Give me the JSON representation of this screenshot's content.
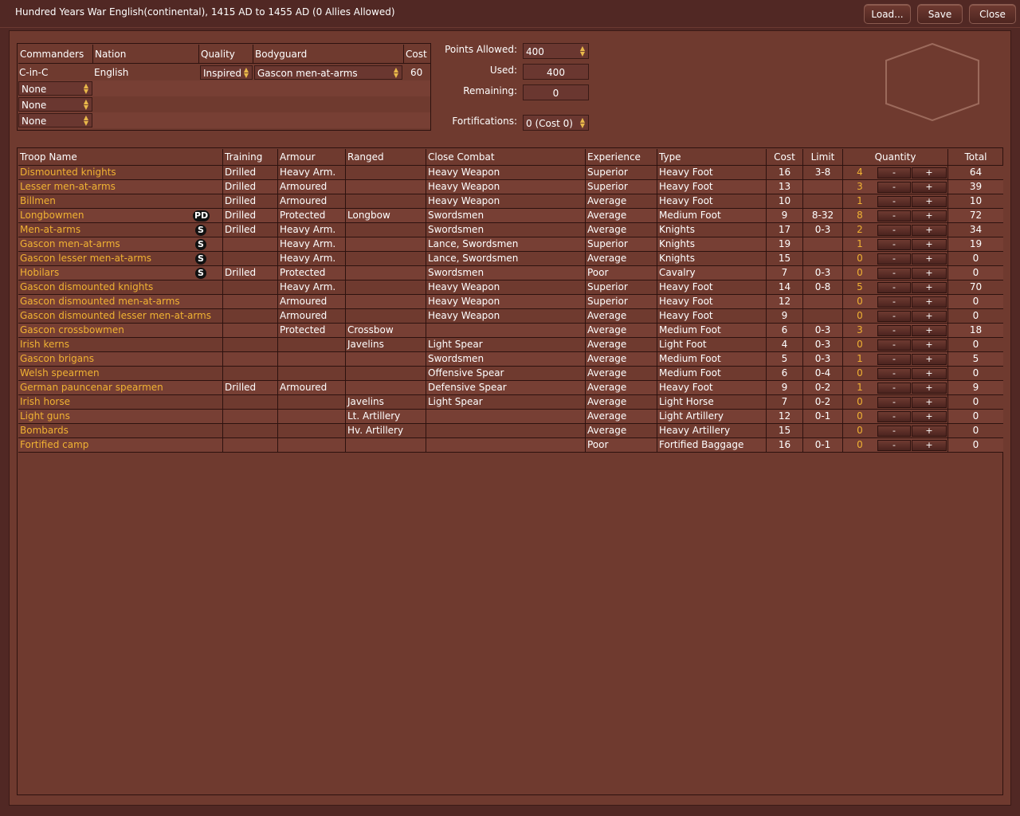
{
  "window": {
    "title": "Hundred Years War English(continental), 1415 AD to 1455 AD (0 Allies Allowed)",
    "buttons": {
      "load": "Load...",
      "save": "Save",
      "close": "Close"
    }
  },
  "commanders": {
    "headers": {
      "commanders": "Commanders",
      "nation": "Nation",
      "quality": "Quality",
      "bodyguard": "Bodyguard",
      "cost": "Cost"
    },
    "cinc": {
      "label": "C-in-C",
      "nation": "English",
      "quality": "Inspired",
      "bodyguard": "Gascon men-at-arms",
      "cost": "60"
    },
    "sub": [
      "None",
      "None",
      "None"
    ]
  },
  "points": {
    "allowed_label": "Points Allowed:",
    "allowed_value": "400",
    "used_label": "Used:",
    "used_value": "400",
    "remaining_label": "Remaining:",
    "remaining_value": "0",
    "fort_label": "Fortifications:",
    "fort_value": "0 (Cost 0)"
  },
  "troops": {
    "headers": {
      "name": "Troop Name",
      "training": "Training",
      "armour": "Armour",
      "ranged": "Ranged",
      "close": "Close Combat",
      "experience": "Experience",
      "type": "Type",
      "cost": "Cost",
      "limit": "Limit",
      "quantity": "Quantity",
      "total": "Total"
    },
    "minus": "-",
    "plus": "+",
    "rows": [
      {
        "name": "Dismounted knights",
        "badge": "",
        "training": "Drilled",
        "armour": "Heavy Arm.",
        "ranged": "",
        "close": "Heavy Weapon",
        "experience": "Superior",
        "type": "Heavy Foot",
        "cost": "16",
        "limit": "3-8",
        "qty": "4",
        "total": "64"
      },
      {
        "name": "Lesser men-at-arms",
        "badge": "",
        "training": "Drilled",
        "armour": "Armoured",
        "ranged": "",
        "close": "Heavy Weapon",
        "experience": "Superior",
        "type": "Heavy Foot",
        "cost": "13",
        "limit": "",
        "qty": "3",
        "total": "39"
      },
      {
        "name": "Billmen",
        "badge": "",
        "training": "Drilled",
        "armour": "Armoured",
        "ranged": "",
        "close": "Heavy Weapon",
        "experience": "Average",
        "type": "Heavy Foot",
        "cost": "10",
        "limit": "",
        "qty": "1",
        "total": "10"
      },
      {
        "name": "Longbowmen",
        "badge": "PD",
        "training": "Drilled",
        "armour": "Protected",
        "ranged": "Longbow",
        "close": "Swordsmen",
        "experience": "Average",
        "type": "Medium Foot",
        "cost": "9",
        "limit": "8-32",
        "qty": "8",
        "total": "72"
      },
      {
        "name": "Men-at-arms",
        "badge": "S",
        "training": "Drilled",
        "armour": "Heavy Arm.",
        "ranged": "",
        "close": "Swordsmen",
        "experience": "Average",
        "type": "Knights",
        "cost": "17",
        "limit": "0-3",
        "qty": "2",
        "total": "34"
      },
      {
        "name": "Gascon men-at-arms",
        "badge": "S",
        "training": "",
        "armour": "Heavy Arm.",
        "ranged": "",
        "close": "Lance, Swordsmen",
        "experience": "Superior",
        "type": "Knights",
        "cost": "19",
        "limit": "",
        "qty": "1",
        "total": "19"
      },
      {
        "name": "Gascon lesser men-at-arms",
        "badge": "S",
        "training": "",
        "armour": "Heavy Arm.",
        "ranged": "",
        "close": "Lance, Swordsmen",
        "experience": "Average",
        "type": "Knights",
        "cost": "15",
        "limit": "",
        "qty": "0",
        "total": "0"
      },
      {
        "name": "Hobilars",
        "badge": "S",
        "training": "Drilled",
        "armour": "Protected",
        "ranged": "",
        "close": "Swordsmen",
        "experience": "Poor",
        "type": "Cavalry",
        "cost": "7",
        "limit": "0-3",
        "qty": "0",
        "total": "0"
      },
      {
        "name": "Gascon dismounted knights",
        "badge": "",
        "training": "",
        "armour": "Heavy Arm.",
        "ranged": "",
        "close": "Heavy Weapon",
        "experience": "Superior",
        "type": "Heavy Foot",
        "cost": "14",
        "limit": "0-8",
        "qty": "5",
        "total": "70"
      },
      {
        "name": "Gascon dismounted men-at-arms",
        "badge": "",
        "training": "",
        "armour": "Armoured",
        "ranged": "",
        "close": "Heavy Weapon",
        "experience": "Superior",
        "type": "Heavy Foot",
        "cost": "12",
        "limit": "",
        "qty": "0",
        "total": "0"
      },
      {
        "name": "Gascon dismounted lesser men-at-arms",
        "badge": "",
        "training": "",
        "armour": "Armoured",
        "ranged": "",
        "close": "Heavy Weapon",
        "experience": "Average",
        "type": "Heavy Foot",
        "cost": "9",
        "limit": "",
        "qty": "0",
        "total": "0"
      },
      {
        "name": "Gascon crossbowmen",
        "badge": "",
        "training": "",
        "armour": "Protected",
        "ranged": "Crossbow",
        "close": "",
        "experience": "Average",
        "type": "Medium Foot",
        "cost": "6",
        "limit": "0-3",
        "qty": "3",
        "total": "18"
      },
      {
        "name": "Irish kerns",
        "badge": "",
        "training": "",
        "armour": "",
        "ranged": "Javelins",
        "close": "Light Spear",
        "experience": "Average",
        "type": "Light Foot",
        "cost": "4",
        "limit": "0-3",
        "qty": "0",
        "total": "0"
      },
      {
        "name": "Gascon brigans",
        "badge": "",
        "training": "",
        "armour": "",
        "ranged": "",
        "close": "Swordsmen",
        "experience": "Average",
        "type": "Medium Foot",
        "cost": "5",
        "limit": "0-3",
        "qty": "1",
        "total": "5"
      },
      {
        "name": "Welsh spearmen",
        "badge": "",
        "training": "",
        "armour": "",
        "ranged": "",
        "close": "Offensive Spear",
        "experience": "Average",
        "type": "Medium Foot",
        "cost": "6",
        "limit": "0-4",
        "qty": "0",
        "total": "0"
      },
      {
        "name": "German pauncenar spearmen",
        "badge": "",
        "training": "Drilled",
        "armour": "Armoured",
        "ranged": "",
        "close": "Defensive Spear",
        "experience": "Average",
        "type": "Heavy Foot",
        "cost": "9",
        "limit": "0-2",
        "qty": "1",
        "total": "9"
      },
      {
        "name": "Irish horse",
        "badge": "",
        "training": "",
        "armour": "",
        "ranged": "Javelins",
        "close": "Light Spear",
        "experience": "Average",
        "type": "Light Horse",
        "cost": "7",
        "limit": "0-2",
        "qty": "0",
        "total": "0"
      },
      {
        "name": "Light guns",
        "badge": "",
        "training": "",
        "armour": "",
        "ranged": "Lt. Artillery",
        "close": "",
        "experience": "Average",
        "type": "Light Artillery",
        "cost": "12",
        "limit": "0-1",
        "qty": "0",
        "total": "0"
      },
      {
        "name": "Bombards",
        "badge": "",
        "training": "",
        "armour": "",
        "ranged": "Hv. Artillery",
        "close": "",
        "experience": "Average",
        "type": "Heavy Artillery",
        "cost": "15",
        "limit": "",
        "qty": "0",
        "total": "0"
      },
      {
        "name": "Fortified camp",
        "badge": "",
        "training": "",
        "armour": "",
        "ranged": "",
        "close": "",
        "experience": "Poor",
        "type": "Fortified Baggage",
        "cost": "16",
        "limit": "0-1",
        "qty": "0",
        "total": "0"
      }
    ]
  },
  "colors": {
    "background": "#512824",
    "panel": "#6f3a2f",
    "row_alt": "#773f34",
    "troop_name": "#f0b233",
    "border": "#2d120f"
  }
}
